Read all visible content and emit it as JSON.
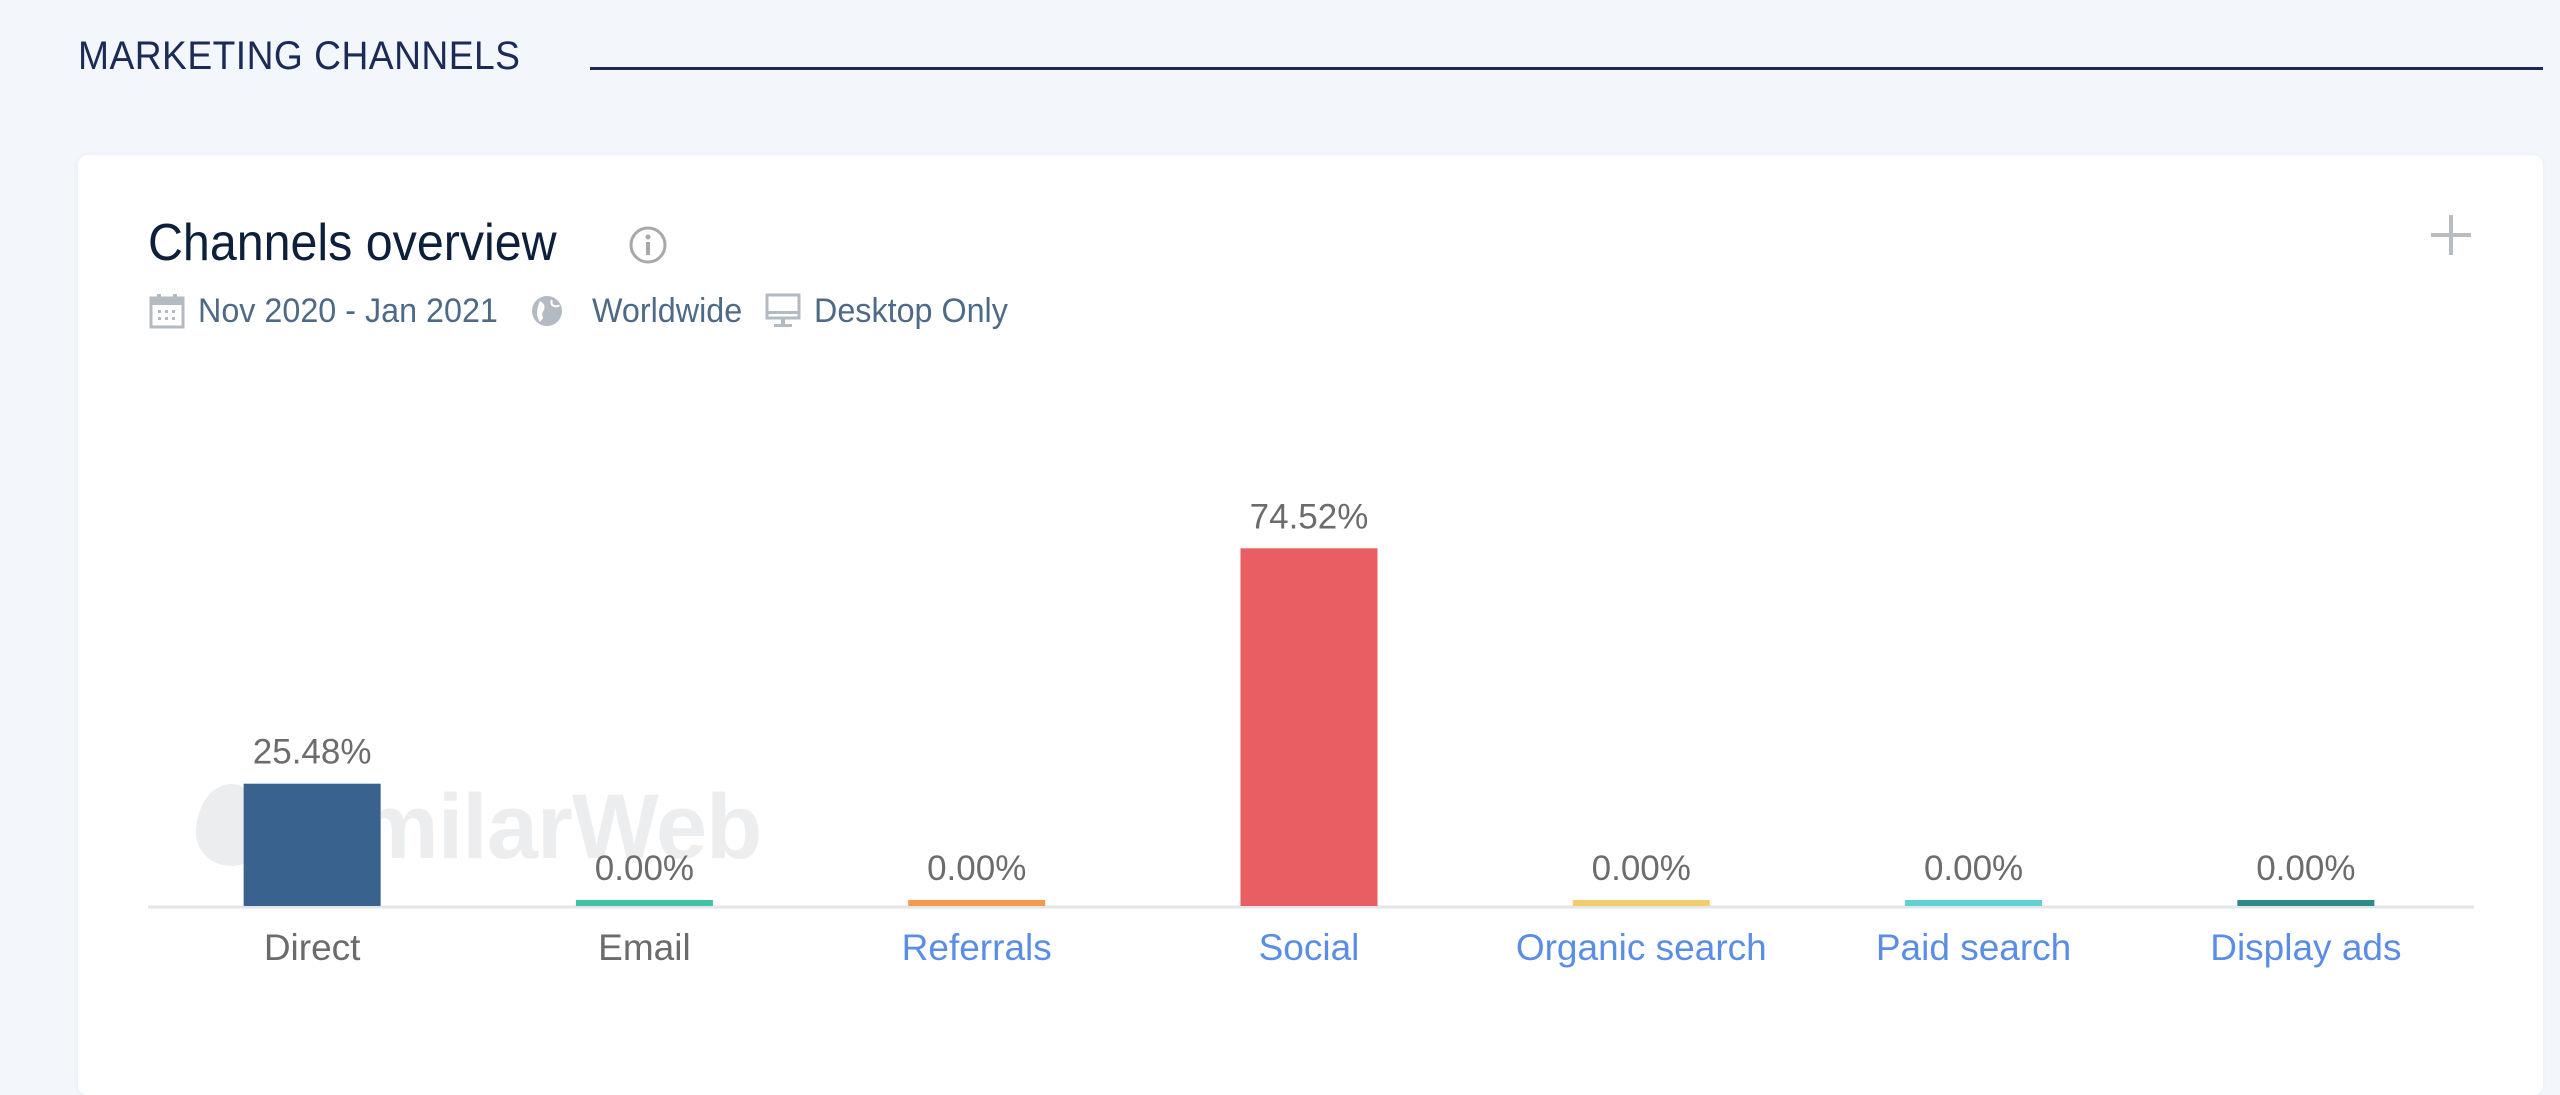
{
  "section": {
    "title": "MARKETING CHANNELS"
  },
  "card": {
    "title": "Channels overview",
    "info_icon": "info-circle-icon",
    "add_icon": "plus-icon",
    "meta": {
      "date_range": "Nov 2020 - Jan 2021",
      "date_icon": "calendar-icon",
      "region": "Worldwide",
      "region_icon": "globe-icon",
      "device": "Desktop Only",
      "device_icon": "desktop-icon"
    },
    "watermark": "SimilarWeb"
  },
  "chart_data": {
    "type": "bar",
    "title": "Channels overview",
    "xlabel": "",
    "ylabel": "",
    "ylim": [
      0,
      100
    ],
    "grid": false,
    "categories": [
      "Direct",
      "Email",
      "Referrals",
      "Social",
      "Organic search",
      "Paid search",
      "Display ads"
    ],
    "values": [
      25.48,
      0.0,
      0.0,
      74.52,
      0.0,
      0.0,
      0.0
    ],
    "value_labels": [
      "25.48%",
      "0.00%",
      "0.00%",
      "74.52%",
      "0.00%",
      "0.00%",
      "0.00%"
    ],
    "colors": [
      "#3a628e",
      "#41c3a8",
      "#f49a4a",
      "#e95e62",
      "#f3cd6a",
      "#5fd0d3",
      "#2e8a8a"
    ],
    "category_links": [
      false,
      false,
      true,
      true,
      true,
      true,
      true
    ],
    "label_colors": {
      "plain": "#6b6b6b",
      "link": "#5a8ee6"
    }
  }
}
